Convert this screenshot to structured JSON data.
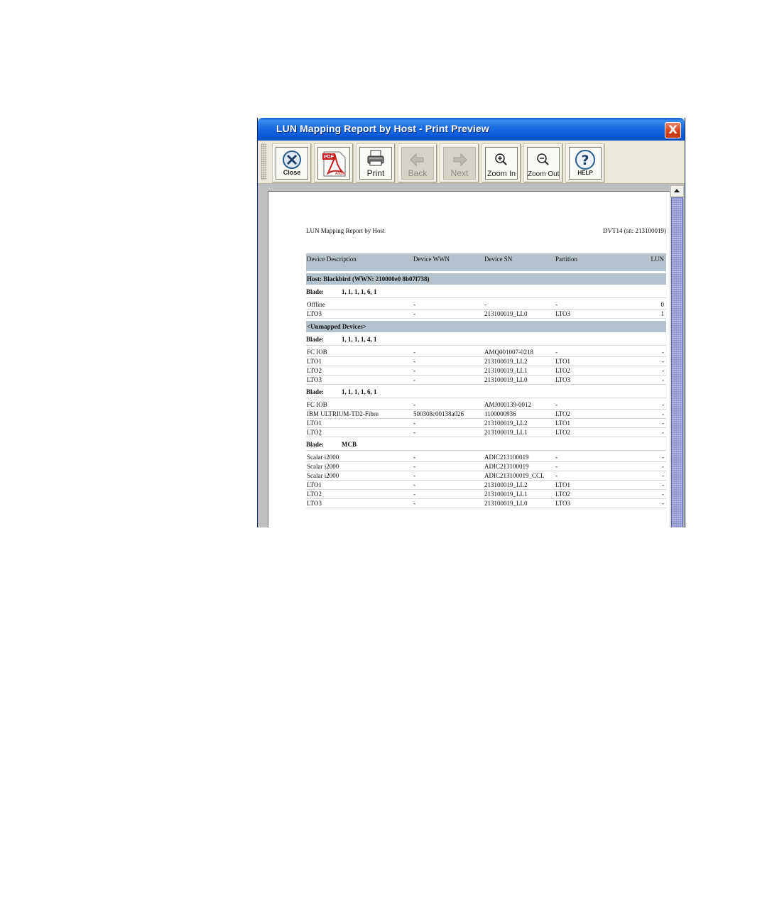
{
  "window": {
    "title": "LUN Mapping Report by Host - Print Preview",
    "close_glyph": "X"
  },
  "toolbar": [
    {
      "name": "close-button",
      "label": "Close",
      "icon": "close-circle-icon",
      "enabled": true
    },
    {
      "name": "pdf-button",
      "label": "",
      "icon": "adobe-pdf-icon",
      "enabled": true
    },
    {
      "name": "print-button",
      "label": "Print",
      "icon": "printer-icon",
      "enabled": true
    },
    {
      "name": "back-button",
      "label": "Back",
      "icon": "left-arrow-icon",
      "enabled": false
    },
    {
      "name": "next-button",
      "label": "Next",
      "icon": "right-arrow-icon",
      "enabled": false
    },
    {
      "name": "zoom-in-button",
      "label": "Zoom In",
      "icon": "magnifier-plus-icon",
      "enabled": true
    },
    {
      "name": "zoom-out-button",
      "label": "Zoom Out",
      "icon": "magnifier-minus-icon",
      "enabled": true
    },
    {
      "name": "help-button",
      "label": "HELP",
      "icon": "question-icon",
      "enabled": true
    }
  ],
  "report": {
    "title": "LUN Mapping Report by Host",
    "library": "DVT14 (sn: 213100019)",
    "columns": [
      "Device Description",
      "Device WWN",
      "Device SN",
      "Partition",
      "LUN"
    ],
    "sections": [
      {
        "heading": "Host: Blackbird (WWN: 210000e0 8b07f738)",
        "blades": [
          {
            "label": "Blade:",
            "value": "1, 1, 1, 1, 6, 1",
            "rows": [
              [
                "Offline",
                "-",
                "-",
                "-",
                "0"
              ],
              [
                "LTO3",
                "-",
                "213100019_LL0",
                "LTO3",
                "1"
              ]
            ]
          }
        ]
      },
      {
        "heading": "<Unmapped Devices>",
        "blades": [
          {
            "label": "Blade:",
            "value": "1, 1, 1, 1, 4, 1",
            "rows": [
              [
                "FC IOB",
                "-",
                "AMQ001007-0218",
                "-",
                "-"
              ],
              [
                "LTO1",
                "-",
                "213100019_LL2",
                "LTO1",
                "-"
              ],
              [
                "LTO2",
                "-",
                "213100019_LL1",
                "LTO2",
                "-"
              ],
              [
                "LTO3",
                "-",
                "213100019_LL0",
                "LTO3",
                "-"
              ]
            ]
          },
          {
            "label": "Blade:",
            "value": "1, 1, 1, 1, 6, 1",
            "rows": [
              [
                "FC IOB",
                "-",
                "AMJ000139-0012",
                "-",
                "-"
              ],
              [
                "IBM ULTRIUM-TD2-Fibre",
                "500308c00138a026",
                "1100000936",
                "LTO2",
                "-"
              ],
              [
                "LTO1",
                "-",
                "213100019_LL2",
                "LTO1",
                "-"
              ],
              [
                "LTO2",
                "-",
                "213100019_LL1",
                "LTO2",
                "-"
              ]
            ]
          },
          {
            "label": "Blade:",
            "value": "MCB",
            "rows": [
              [
                "Scalar i2000",
                "-",
                "ADIC213100019",
                "-",
                "-"
              ],
              [
                "Scalar i2000",
                "-",
                "ADIC213100019",
                "-",
                "-"
              ],
              [
                "Scalar i2000",
                "-",
                "ADIC213100019_CCL",
                "-",
                "-"
              ],
              [
                "LTO1",
                "-",
                "213100019_LL2",
                "LTO1",
                "-"
              ],
              [
                "LTO2",
                "-",
                "213100019_LL1",
                "LTO2",
                "-"
              ],
              [
                "LTO3",
                "-",
                "213100019_LL0",
                "LTO3",
                "-"
              ]
            ]
          }
        ]
      }
    ]
  }
}
